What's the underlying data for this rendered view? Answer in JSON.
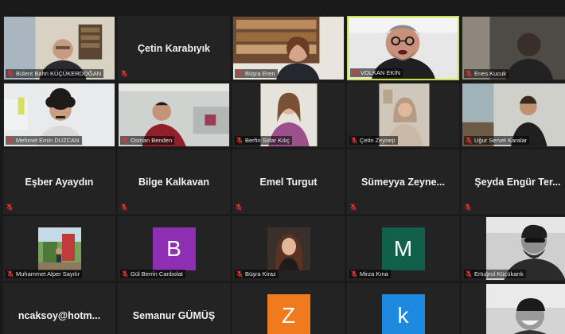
{
  "participants": [
    {
      "name": "Bülent Bahri KÜÇÜKERDOĞAN",
      "type": "video",
      "scene": "office-man"
    },
    {
      "name": "Çetin Karabıyık",
      "type": "name"
    },
    {
      "name": "Büşra Eren",
      "type": "video",
      "scene": "bookshelf-woman"
    },
    {
      "name": "VOLKAN EKİN",
      "type": "video",
      "scene": "speaker",
      "active": true
    },
    {
      "name": "Enes Kucuk",
      "type": "video",
      "scene": "dark-man"
    },
    {
      "name": "Mehmet Emin DUZCAN",
      "type": "video",
      "scene": "curly-man"
    },
    {
      "name": "Osman Benden",
      "type": "video",
      "scene": "sofa-man"
    },
    {
      "name": "Berfin Sidar Kılıç",
      "type": "video",
      "scene": "woman-pink"
    },
    {
      "name": "Çetin Zeynep",
      "type": "video",
      "scene": "hijab-woman"
    },
    {
      "name": "Uğur Servet Karalar",
      "type": "video",
      "scene": "room-man"
    },
    {
      "name": "Eşber Ayaydın",
      "type": "name"
    },
    {
      "name": "Bilge Kalkavan",
      "type": "name"
    },
    {
      "name": "Emel Turgut",
      "type": "name"
    },
    {
      "name": "Sümeyya  Zeyne...",
      "type": "name"
    },
    {
      "name": "Şeyda Engür Ter...",
      "type": "name"
    },
    {
      "name": "Muhammet Alper Sayılır",
      "type": "photo",
      "scene": "outdoor"
    },
    {
      "name": "Gül Berrin Canbolat",
      "type": "avatar",
      "letter": "B",
      "color": "#8e2fb3"
    },
    {
      "name": "Büşra Kiraz",
      "type": "photo",
      "scene": "portrait-woman"
    },
    {
      "name": "Mirza Kına",
      "type": "avatar",
      "letter": "M",
      "color": "#11614a"
    },
    {
      "name": "Ertuğrul Küçükarık",
      "type": "photo-wide",
      "scene": "bw-man"
    },
    {
      "name": "ncaksoy@hotm...",
      "type": "name"
    },
    {
      "name": "Semanur GÜMÜŞ",
      "type": "name"
    },
    {
      "name": "",
      "type": "avatar",
      "letter": "Z",
      "color": "#f07a1e"
    },
    {
      "name": "",
      "type": "avatar",
      "letter": "k",
      "color": "#1d8ae0"
    },
    {
      "name": "",
      "type": "photo-wide",
      "scene": "bw-laugh"
    }
  ],
  "icons": {
    "muted": "mic-off-icon"
  },
  "colors": {
    "background": "#1a1a1a",
    "tile": "#232323",
    "active_border": "#c8e24a",
    "muted_red": "#e5322d"
  }
}
